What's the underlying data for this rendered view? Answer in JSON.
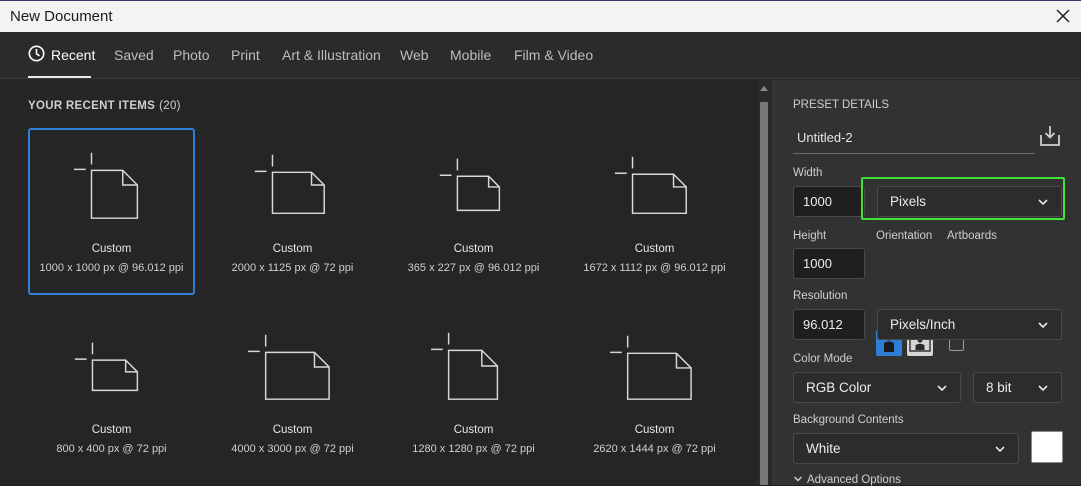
{
  "window": {
    "title": "New Document"
  },
  "tabs": [
    {
      "label": "Recent"
    },
    {
      "label": "Saved"
    },
    {
      "label": "Photo"
    },
    {
      "label": "Print"
    },
    {
      "label": "Art & Illustration"
    },
    {
      "label": "Web"
    },
    {
      "label": "Mobile"
    },
    {
      "label": "Film & Video"
    }
  ],
  "recent": {
    "heading": "YOUR RECENT ITEMS",
    "count": "(20)",
    "items": [
      {
        "name": "Custom",
        "dims": "1000 x 1000 px @ 96.012 ppi"
      },
      {
        "name": "Custom",
        "dims": "2000 x 1125 px @ 72 ppi"
      },
      {
        "name": "Custom",
        "dims": "365 x 227 px @ 96.012 ppi"
      },
      {
        "name": "Custom",
        "dims": "1672 x 1112 px @ 96.012 ppi"
      },
      {
        "name": "Custom",
        "dims": "800 x 400 px @ 72 ppi"
      },
      {
        "name": "Custom",
        "dims": "4000 x 3000 px @ 72 ppi"
      },
      {
        "name": "Custom",
        "dims": "1280 x 1280 px @ 72 ppi"
      },
      {
        "name": "Custom",
        "dims": "2620 x 1444 px @ 72 ppi"
      }
    ]
  },
  "preset": {
    "heading": "PRESET DETAILS",
    "name": "Untitled-2",
    "width_label": "Width",
    "width_value": "1000",
    "width_unit": "Pixels",
    "height_label": "Height",
    "height_value": "1000",
    "orientation_label": "Orientation",
    "artboards_label": "Artboards",
    "resolution_label": "Resolution",
    "resolution_value": "96.012",
    "resolution_unit": "Pixels/Inch",
    "color_mode_label": "Color Mode",
    "color_mode": "RGB Color",
    "bit_depth": "8 bit",
    "background_label": "Background Contents",
    "background": "White",
    "advanced_label": "Advanced Options"
  },
  "colors": {
    "selection": "#2f7fd6",
    "highlight": "#3ee23a",
    "background_swatch": "#ffffff"
  }
}
